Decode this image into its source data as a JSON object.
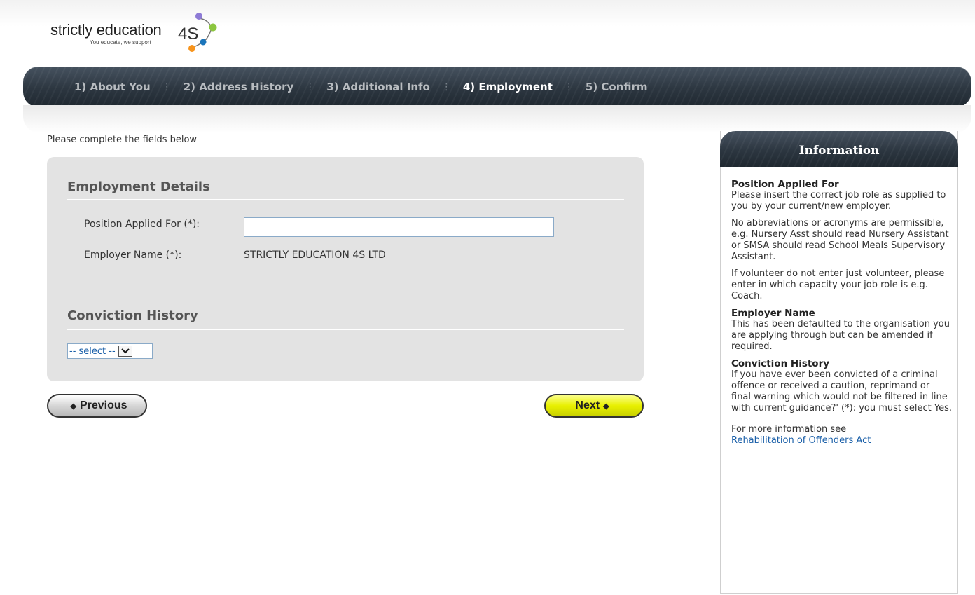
{
  "brand": {
    "name": "strictly education",
    "suffix": "4S",
    "tagline": "You educate, we support"
  },
  "nav": {
    "steps": [
      {
        "label": "1) About You"
      },
      {
        "label": "2) Address History"
      },
      {
        "label": "3) Additional Info"
      },
      {
        "label": "4) Employment"
      },
      {
        "label": "5) Confirm"
      }
    ],
    "active_step": 4
  },
  "form": {
    "intro": "Please complete the fields below",
    "employment_section_title": "Employment Details",
    "position_label": "Position Applied For (*):",
    "position_value": "",
    "employer_label": "Employer Name (*):",
    "employer_value": "STRICTLY EDUCATION 4S LTD",
    "conviction_section_title": "Conviction History",
    "conviction_select_value": "-- select --"
  },
  "buttons": {
    "previous": "Previous",
    "next": "Next"
  },
  "info": {
    "title": "Information",
    "position_heading": "Position Applied For",
    "position_text_1": "Please insert the correct job role as supplied to you by your current/new employer.",
    "position_text_2": "No abbreviations or acronyms are permissible, e.g. Nursery Asst should read Nursery Assistant or SMSA should read School Meals Supervisory Assistant.",
    "position_text_3": "If volunteer do not enter just volunteer, please enter in which capacity your job role is e.g. Coach.",
    "employer_heading": "Employer Name",
    "employer_text": "This has been defaulted to the organisation you are applying through but can be amended if required.",
    "conviction_heading": "Conviction History",
    "conviction_text": "If you have ever been convicted of a criminal offence or received a caution, reprimand or final warning which would not be filtered in line with current guidance?' (*): you must select Yes.",
    "more_text": "For more information see",
    "more_link": "Rehabilitation of Offenders Act"
  },
  "colors": {
    "nav_dark": "#2c3640",
    "panel_bg": "#e3e3e3",
    "next_button": "#e8f000",
    "link": "#1a5fa8"
  }
}
